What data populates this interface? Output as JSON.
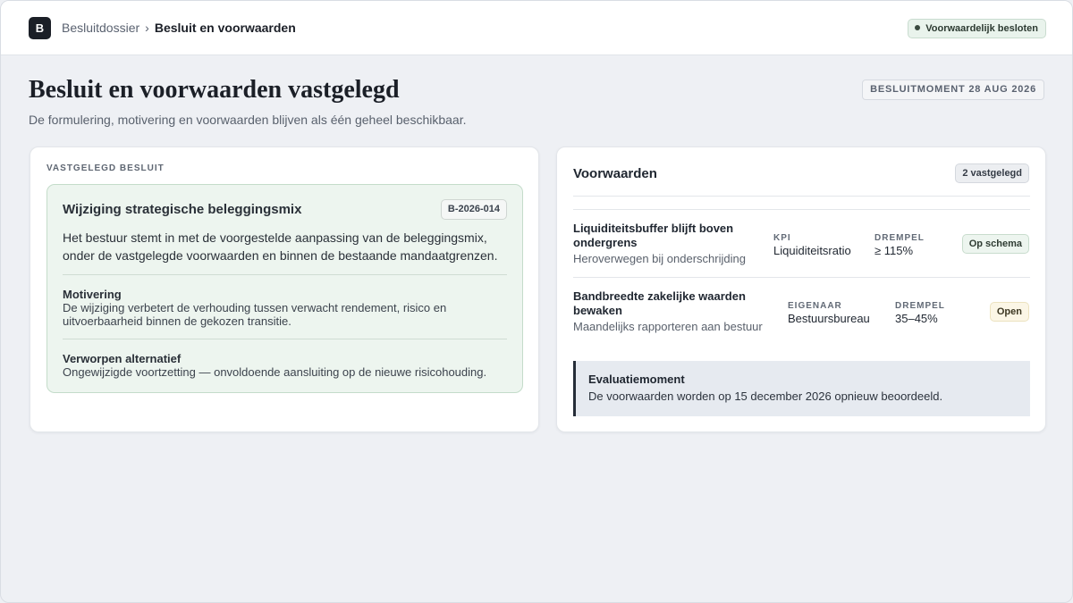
{
  "header": {
    "logo_letter": "B",
    "breadcrumb_parent": "Besluitdossier",
    "breadcrumb_separator": "›",
    "breadcrumb_current": "Besluit en voorwaarden",
    "status_badge": "Voorwaardelijk besloten"
  },
  "page": {
    "title": "Besluit en voorwaarden vastgelegd",
    "subtitle": "De formulering, motivering en voorwaarden blijven als één geheel beschikbaar.",
    "moment_badge": "BESLUITMOMENT 28 AUG 2026"
  },
  "decision": {
    "section_label": "VASTGELEGD BESLUIT",
    "title": "Wijziging strategische beleggingsmix",
    "id": "B-2026-014",
    "text": "Het bestuur stemt in met de voorgestelde aanpassing van de beleggingsmix, onder de vastgelegde voorwaarden en binnen de bestaande mandaatgrenzen.",
    "motivation_label": "Motivering",
    "motivation_text": "De wijziging verbetert de verhouding tussen verwacht rendement, risico en uitvoerbaarheid binnen de gekozen transitie.",
    "rejected_label": "Verworpen alternatief",
    "rejected_text": "Ongewijzigde voortzetting — onvoldoende aansluiting op de nieuwe risicohouding."
  },
  "conditions": {
    "title": "Voorwaarden",
    "count_badge": "2 vastgelegd",
    "items": [
      {
        "name": "Liquiditeitsbuffer blijft boven ondergrens",
        "description": "Heroverwegen bij onderschrijding",
        "meta1_label": "KPI",
        "meta1_value": "Liquiditeitsratio",
        "meta2_label": "DREMPEL",
        "meta2_value": "≥ 115%",
        "status": "Op schema",
        "status_color": "#edf5ef"
      },
      {
        "name": "Bandbreedte zakelijke waarden bewaken",
        "description": "Maandelijks rapporteren aan bestuur",
        "meta1_label": "EIGENAAR",
        "meta1_value": "Bestuursbureau",
        "meta2_label": "DREMPEL",
        "meta2_value": "35–45%",
        "status": "Open",
        "status_color": "#fbf6e6"
      }
    ],
    "evaluation_label": "Evaluatiemoment",
    "evaluation_text": "De voorwaarden worden op 15 december 2026 opnieuw beoordeeld."
  }
}
